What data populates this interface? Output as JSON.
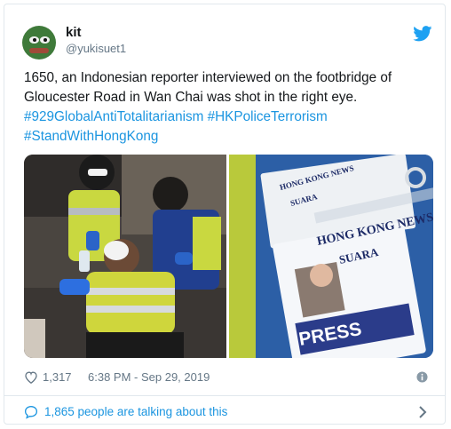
{
  "author": {
    "name": "kit",
    "handle": "@yukisuet1"
  },
  "tweet": {
    "text_line1": "1650, an Indonesian reporter interviewed on the footbridge of",
    "text_line2": "Gloucester Road in Wan Chai was shot in the right eye.",
    "hashtag1": "#929GlobalAntiTotalitarianism",
    "hashtag2": "#HKPoliceTerrorism",
    "hashtag3": "#StandWithHongKong"
  },
  "press_card": {
    "small_card_title": "HONG KONG NEWS",
    "small_card_sub": "SUARA",
    "title": "HONG KONG NEWS",
    "subtitle": "SUARA",
    "press": "PRESS"
  },
  "footer": {
    "likes": "1,317",
    "timestamp": "6:38 PM - Sep 29, 2019",
    "talking": "1,865 people are talking about this"
  },
  "colors": {
    "link": "#1b95e0",
    "muted": "#657786",
    "border": "#e1e8ed"
  },
  "icons": [
    "twitter-bird-icon",
    "heart-icon",
    "info-icon",
    "speech-bubble-icon",
    "chevron-right-icon"
  ]
}
